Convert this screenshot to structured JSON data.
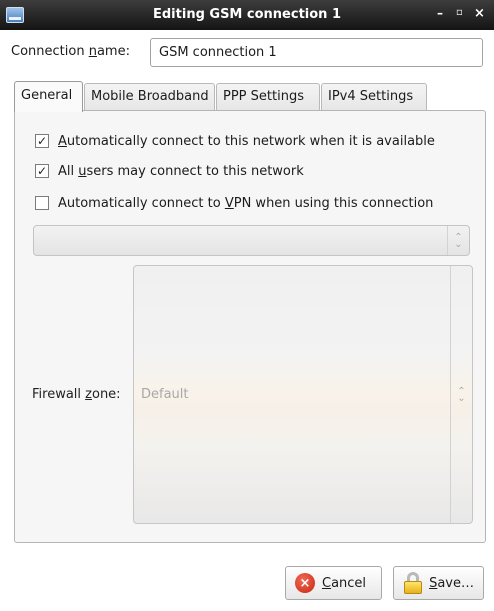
{
  "window": {
    "title": "Editing GSM connection 1",
    "controls": {
      "minimize": "–",
      "maximize": "▫",
      "close": "×"
    }
  },
  "connection": {
    "label_pre": "Connection ",
    "label_key": "n",
    "label_post": "ame:",
    "value": "GSM connection 1"
  },
  "tabs": [
    {
      "label": "General",
      "active": true
    },
    {
      "label": "Mobile Broadband",
      "active": false
    },
    {
      "label": "PPP Settings",
      "active": false
    },
    {
      "label": "IPv4 Settings",
      "active": false
    }
  ],
  "general": {
    "options": [
      {
        "pre": "",
        "key": "A",
        "post": "utomatically connect to this network when it is available",
        "checked": true
      },
      {
        "pre": "All ",
        "key": "u",
        "post": "sers may connect to this network",
        "checked": true
      },
      {
        "pre": "Automatically connect to ",
        "key": "V",
        "post": "PN when using this connection",
        "checked": false
      }
    ],
    "check_mark": "✓",
    "vpn_select_value": "",
    "firewall": {
      "label_pre": "Firewall ",
      "label_key": "z",
      "label_post": "one:",
      "value": "Default"
    }
  },
  "buttons": {
    "cancel": {
      "pre": "",
      "key": "C",
      "post": "ancel"
    },
    "save": {
      "pre": "",
      "key": "S",
      "post": "ave…"
    }
  },
  "icons": {
    "window": "network-connection-icon",
    "cancel": "cancel-icon",
    "save": "lock-icon"
  },
  "colors": {
    "titlebar": "#1f1f1f",
    "panel": "#f6f6f6",
    "cancel_red": "#d9341c"
  }
}
